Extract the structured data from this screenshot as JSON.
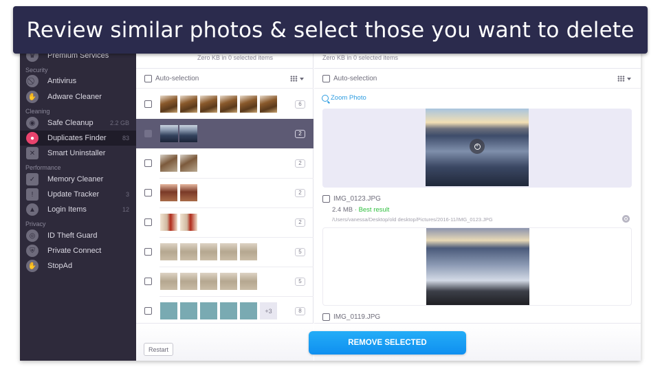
{
  "banner": {
    "text": "Review similar photos & select those you want to delete"
  },
  "sidebar": {
    "sections": {
      "security": "Security",
      "cleaning": "Cleaning",
      "performance": "Performance",
      "privacy": "Privacy"
    },
    "items": [
      {
        "label": "Premium Services",
        "icon": "premium-icon",
        "count": ""
      },
      {
        "label": "Antivirus",
        "icon": "antivirus-icon",
        "count": ""
      },
      {
        "label": "Adware Cleaner",
        "icon": "hand-stop-icon",
        "count": ""
      },
      {
        "label": "Safe Cleanup",
        "icon": "cleanup-disc-icon",
        "count": "2.2 GB"
      },
      {
        "label": "Duplicates Finder",
        "icon": "duplicates-icon",
        "count": "83",
        "active": true
      },
      {
        "label": "Smart Uninstaller",
        "icon": "uninstaller-icon",
        "count": ""
      },
      {
        "label": "Memory Cleaner",
        "icon": "memory-chip-icon",
        "count": ""
      },
      {
        "label": "Update Tracker",
        "icon": "update-tracker-icon",
        "count": "3"
      },
      {
        "label": "Login Items",
        "icon": "rocket-icon",
        "count": "12"
      },
      {
        "label": "ID Theft Guard",
        "icon": "id-theft-icon",
        "count": ""
      },
      {
        "label": "Private Connect",
        "icon": "vpn-shield-icon",
        "count": ""
      },
      {
        "label": "StopAd",
        "icon": "stopad-icon",
        "count": ""
      }
    ]
  },
  "groups_panel": {
    "summary": "Zero KB in 0 selected items",
    "auto_selection_label": "Auto-selection",
    "groups": [
      {
        "count": "6",
        "thumbs": [
          "brown",
          "brown",
          "brown",
          "brown",
          "brown",
          "brown"
        ],
        "more": ""
      },
      {
        "count": "2",
        "thumbs": [
          "sea",
          "sea"
        ],
        "more": "",
        "selected": true
      },
      {
        "count": "2",
        "thumbs": [
          "bench",
          "bench"
        ],
        "more": ""
      },
      {
        "count": "2",
        "thumbs": [
          "crowd",
          "crowd"
        ],
        "more": ""
      },
      {
        "count": "2",
        "thumbs": [
          "girl",
          "girl"
        ],
        "more": ""
      },
      {
        "count": "5",
        "thumbs": [
          "doc",
          "doc",
          "doc",
          "doc",
          "doc"
        ],
        "more": ""
      },
      {
        "count": "5",
        "thumbs": [
          "doc",
          "doc",
          "doc",
          "doc",
          "doc"
        ],
        "more": ""
      },
      {
        "count": "8",
        "thumbs": [
          "teal",
          "teal",
          "teal",
          "teal",
          "teal"
        ],
        "more": "+3"
      }
    ],
    "restart_label": "Restart"
  },
  "detail_panel": {
    "summary": "Zero KB in 0 selected items",
    "auto_selection_label": "Auto-selection",
    "zoom_photo_label": "Zoom Photo",
    "files": [
      {
        "name": "IMG_0123.JPG",
        "size": "2.4 MB",
        "separator": "·",
        "badge": "Best result",
        "path": "/Users/vanessa/Desktop/old desktop/Pictures/2016-11/IMG_0123.JPG"
      },
      {
        "name": "IMG_0119.JPG"
      }
    ]
  },
  "remove_button_label": "REMOVE SELECTED",
  "colors": {
    "banner_bg": "#2b2b4d",
    "sidebar_bg": "#2e2a3b",
    "selected_row_bg": "#5d5a74",
    "accent_blue": "#1a9ef3",
    "best_result_green": "#2fbf3e",
    "duplicates_icon_pink": "#e8436d"
  }
}
